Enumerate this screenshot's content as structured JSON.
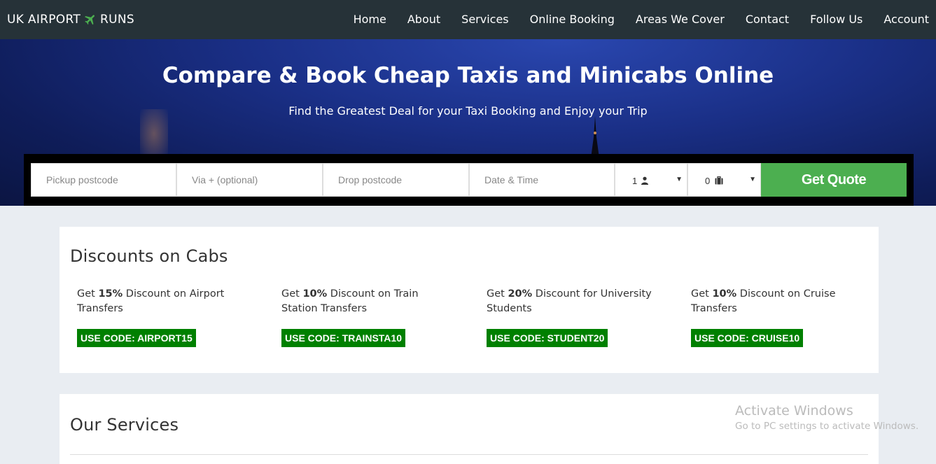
{
  "brand": {
    "left": "UK AIRPORT",
    "right": "RUNS",
    "plane_icon": "plane-icon",
    "plane_color": "#4caf50"
  },
  "nav": {
    "items": [
      "Home",
      "About",
      "Services",
      "Online Booking",
      "Areas We Cover",
      "Contact",
      "Follow Us",
      "Account"
    ]
  },
  "hero": {
    "title": "Compare & Book Cheap Taxis and Minicabs Online",
    "subtitle": "Find the Greatest Deal for your Taxi Booking and Enjoy your Trip"
  },
  "booking": {
    "pickup_placeholder": "Pickup postcode",
    "via_placeholder": "Via + (optional)",
    "drop_placeholder": "Drop postcode",
    "datetime_placeholder": "Date & Time",
    "passengers_value": "1",
    "passengers_icon": "user-icon",
    "luggage_value": "0",
    "luggage_icon": "suitcase-icon",
    "submit_label": "Get Quote",
    "submit_color": "#4caf50"
  },
  "discounts": {
    "title": "Discounts on Cabs",
    "code_color": "#008000",
    "deals": [
      {
        "prefix": "Get ",
        "pct": "15%",
        "suffix": " Discount on Airport Transfers",
        "code": "USE CODE: AIRPORT15"
      },
      {
        "prefix": "Get ",
        "pct": "10%",
        "suffix": " Discount on Train Station Transfers",
        "code": "USE CODE: TRAINSTA10"
      },
      {
        "prefix": "Get ",
        "pct": "20%",
        "suffix": " Discount for University Students",
        "code": "USE CODE: STUDENT20"
      },
      {
        "prefix": "Get ",
        "pct": "10%",
        "suffix": " Discount on Cruise Transfers",
        "code": "USE CODE: CRUISE10"
      }
    ]
  },
  "services": {
    "title": "Our Services"
  },
  "watermark": {
    "line1": "Activate Windows",
    "line2": "Go to PC settings to activate Windows."
  }
}
